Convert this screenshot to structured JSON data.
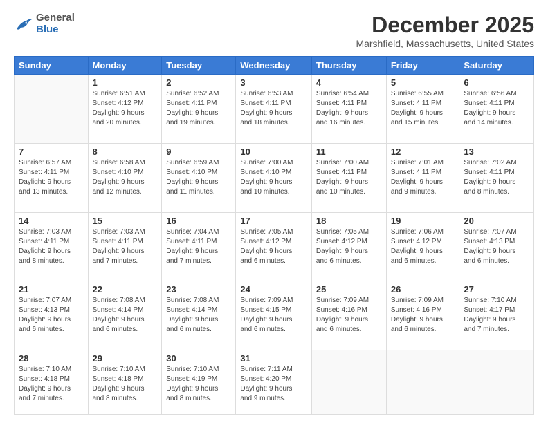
{
  "header": {
    "logo_general": "General",
    "logo_blue": "Blue",
    "month_title": "December 2025",
    "location": "Marshfield, Massachusetts, United States"
  },
  "days_of_week": [
    "Sunday",
    "Monday",
    "Tuesday",
    "Wednesday",
    "Thursday",
    "Friday",
    "Saturday"
  ],
  "weeks": [
    [
      {
        "day": "",
        "info": ""
      },
      {
        "day": "1",
        "info": "Sunrise: 6:51 AM\nSunset: 4:12 PM\nDaylight: 9 hours\nand 20 minutes."
      },
      {
        "day": "2",
        "info": "Sunrise: 6:52 AM\nSunset: 4:11 PM\nDaylight: 9 hours\nand 19 minutes."
      },
      {
        "day": "3",
        "info": "Sunrise: 6:53 AM\nSunset: 4:11 PM\nDaylight: 9 hours\nand 18 minutes."
      },
      {
        "day": "4",
        "info": "Sunrise: 6:54 AM\nSunset: 4:11 PM\nDaylight: 9 hours\nand 16 minutes."
      },
      {
        "day": "5",
        "info": "Sunrise: 6:55 AM\nSunset: 4:11 PM\nDaylight: 9 hours\nand 15 minutes."
      },
      {
        "day": "6",
        "info": "Sunrise: 6:56 AM\nSunset: 4:11 PM\nDaylight: 9 hours\nand 14 minutes."
      }
    ],
    [
      {
        "day": "7",
        "info": "Sunrise: 6:57 AM\nSunset: 4:11 PM\nDaylight: 9 hours\nand 13 minutes."
      },
      {
        "day": "8",
        "info": "Sunrise: 6:58 AM\nSunset: 4:10 PM\nDaylight: 9 hours\nand 12 minutes."
      },
      {
        "day": "9",
        "info": "Sunrise: 6:59 AM\nSunset: 4:10 PM\nDaylight: 9 hours\nand 11 minutes."
      },
      {
        "day": "10",
        "info": "Sunrise: 7:00 AM\nSunset: 4:10 PM\nDaylight: 9 hours\nand 10 minutes."
      },
      {
        "day": "11",
        "info": "Sunrise: 7:00 AM\nSunset: 4:11 PM\nDaylight: 9 hours\nand 10 minutes."
      },
      {
        "day": "12",
        "info": "Sunrise: 7:01 AM\nSunset: 4:11 PM\nDaylight: 9 hours\nand 9 minutes."
      },
      {
        "day": "13",
        "info": "Sunrise: 7:02 AM\nSunset: 4:11 PM\nDaylight: 9 hours\nand 8 minutes."
      }
    ],
    [
      {
        "day": "14",
        "info": "Sunrise: 7:03 AM\nSunset: 4:11 PM\nDaylight: 9 hours\nand 8 minutes."
      },
      {
        "day": "15",
        "info": "Sunrise: 7:03 AM\nSunset: 4:11 PM\nDaylight: 9 hours\nand 7 minutes."
      },
      {
        "day": "16",
        "info": "Sunrise: 7:04 AM\nSunset: 4:11 PM\nDaylight: 9 hours\nand 7 minutes."
      },
      {
        "day": "17",
        "info": "Sunrise: 7:05 AM\nSunset: 4:12 PM\nDaylight: 9 hours\nand 6 minutes."
      },
      {
        "day": "18",
        "info": "Sunrise: 7:05 AM\nSunset: 4:12 PM\nDaylight: 9 hours\nand 6 minutes."
      },
      {
        "day": "19",
        "info": "Sunrise: 7:06 AM\nSunset: 4:12 PM\nDaylight: 9 hours\nand 6 minutes."
      },
      {
        "day": "20",
        "info": "Sunrise: 7:07 AM\nSunset: 4:13 PM\nDaylight: 9 hours\nand 6 minutes."
      }
    ],
    [
      {
        "day": "21",
        "info": "Sunrise: 7:07 AM\nSunset: 4:13 PM\nDaylight: 9 hours\nand 6 minutes."
      },
      {
        "day": "22",
        "info": "Sunrise: 7:08 AM\nSunset: 4:14 PM\nDaylight: 9 hours\nand 6 minutes."
      },
      {
        "day": "23",
        "info": "Sunrise: 7:08 AM\nSunset: 4:14 PM\nDaylight: 9 hours\nand 6 minutes."
      },
      {
        "day": "24",
        "info": "Sunrise: 7:09 AM\nSunset: 4:15 PM\nDaylight: 9 hours\nand 6 minutes."
      },
      {
        "day": "25",
        "info": "Sunrise: 7:09 AM\nSunset: 4:16 PM\nDaylight: 9 hours\nand 6 minutes."
      },
      {
        "day": "26",
        "info": "Sunrise: 7:09 AM\nSunset: 4:16 PM\nDaylight: 9 hours\nand 6 minutes."
      },
      {
        "day": "27",
        "info": "Sunrise: 7:10 AM\nSunset: 4:17 PM\nDaylight: 9 hours\nand 7 minutes."
      }
    ],
    [
      {
        "day": "28",
        "info": "Sunrise: 7:10 AM\nSunset: 4:18 PM\nDaylight: 9 hours\nand 7 minutes."
      },
      {
        "day": "29",
        "info": "Sunrise: 7:10 AM\nSunset: 4:18 PM\nDaylight: 9 hours\nand 8 minutes."
      },
      {
        "day": "30",
        "info": "Sunrise: 7:10 AM\nSunset: 4:19 PM\nDaylight: 9 hours\nand 8 minutes."
      },
      {
        "day": "31",
        "info": "Sunrise: 7:11 AM\nSunset: 4:20 PM\nDaylight: 9 hours\nand 9 minutes."
      },
      {
        "day": "",
        "info": ""
      },
      {
        "day": "",
        "info": ""
      },
      {
        "day": "",
        "info": ""
      }
    ]
  ]
}
